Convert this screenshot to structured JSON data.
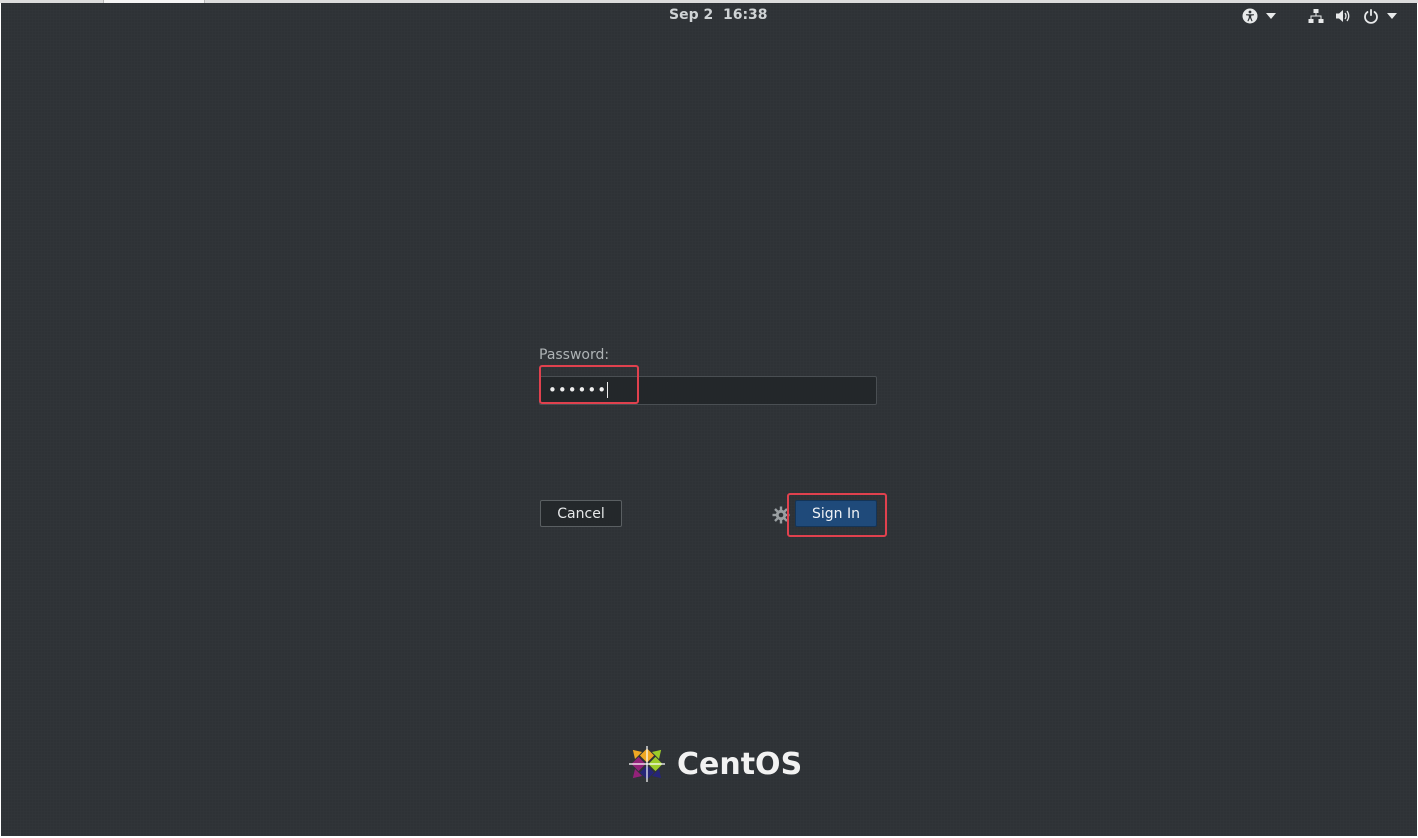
{
  "topbar": {
    "clock": "Sep 2  16:38",
    "icons": [
      "accessibility-icon",
      "chevron-down-icon",
      "network-icon",
      "volume-icon",
      "power-icon",
      "chevron-down-icon"
    ]
  },
  "login": {
    "password_label": "Password:",
    "password_value": "••••••",
    "cancel_label": "Cancel",
    "signin_label": "Sign In",
    "settings_icon": "gear-icon"
  },
  "branding": {
    "logo_text": "CentOS"
  },
  "colors": {
    "background": "#2e3236",
    "signin_accent": "#1f4a7a",
    "highlight": "#e0414e"
  }
}
